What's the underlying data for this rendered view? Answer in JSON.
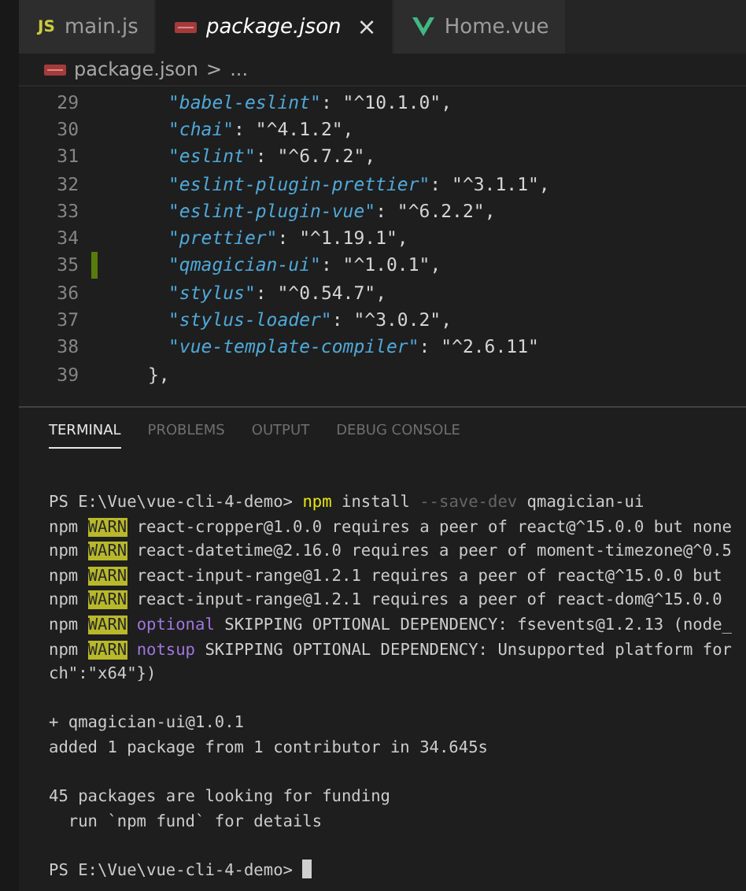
{
  "tabs": [
    {
      "label": "main.js",
      "icon": {
        "kind": "js",
        "text": "JS"
      },
      "selected": false,
      "preview": false
    },
    {
      "label": "package.json",
      "icon": {
        "kind": "json"
      },
      "selected": true,
      "preview": true,
      "close": "×"
    },
    {
      "label": "Home.vue",
      "icon": {
        "kind": "vue"
      },
      "selected": false,
      "preview": false
    }
  ],
  "breadcrumb": {
    "file": "package.json",
    "icon": {
      "kind": "json"
    },
    "separator": ">",
    "rest": "..."
  },
  "editor": {
    "lines": [
      {
        "number": "29",
        "kind": "entry",
        "modified": false,
        "segments": [
          {
            "kind": "key",
            "text": "\"babel-eslint\""
          },
          {
            "kind": "punct",
            "text": ": "
          },
          {
            "kind": "string",
            "text": "\"^10.1.0\""
          },
          {
            "kind": "punct",
            "text": ","
          }
        ]
      },
      {
        "number": "30",
        "kind": "entry",
        "modified": false,
        "segments": [
          {
            "kind": "key",
            "text": "\"chai\""
          },
          {
            "kind": "punct",
            "text": ": "
          },
          {
            "kind": "string",
            "text": "\"^4.1.2\""
          },
          {
            "kind": "punct",
            "text": ","
          }
        ]
      },
      {
        "number": "31",
        "kind": "entry",
        "modified": false,
        "segments": [
          {
            "kind": "key",
            "text": "\"eslint\""
          },
          {
            "kind": "punct",
            "text": ": "
          },
          {
            "kind": "string",
            "text": "\"^6.7.2\""
          },
          {
            "kind": "punct",
            "text": ","
          }
        ]
      },
      {
        "number": "32",
        "kind": "entry",
        "modified": false,
        "segments": [
          {
            "kind": "key",
            "text": "\"eslint-plugin-prettier\""
          },
          {
            "kind": "punct",
            "text": ": "
          },
          {
            "kind": "string",
            "text": "\"^3.1.1\""
          },
          {
            "kind": "punct",
            "text": ","
          }
        ]
      },
      {
        "number": "33",
        "kind": "entry",
        "modified": false,
        "segments": [
          {
            "kind": "key",
            "text": "\"eslint-plugin-vue\""
          },
          {
            "kind": "punct",
            "text": ": "
          },
          {
            "kind": "string",
            "text": "\"^6.2.2\""
          },
          {
            "kind": "punct",
            "text": ","
          }
        ]
      },
      {
        "number": "34",
        "kind": "entry",
        "modified": false,
        "segments": [
          {
            "kind": "key",
            "text": "\"prettier\""
          },
          {
            "kind": "punct",
            "text": ": "
          },
          {
            "kind": "string",
            "text": "\"^1.19.1\""
          },
          {
            "kind": "punct",
            "text": ","
          }
        ]
      },
      {
        "number": "35",
        "kind": "entry",
        "modified": true,
        "segments": [
          {
            "kind": "key",
            "text": "\"qmagician-ui\""
          },
          {
            "kind": "punct",
            "text": ": "
          },
          {
            "kind": "string",
            "text": "\"^1.0.1\""
          },
          {
            "kind": "punct",
            "text": ","
          }
        ]
      },
      {
        "number": "36",
        "kind": "entry",
        "modified": false,
        "segments": [
          {
            "kind": "key",
            "text": "\"stylus\""
          },
          {
            "kind": "punct",
            "text": ": "
          },
          {
            "kind": "string",
            "text": "\"^0.54.7\""
          },
          {
            "kind": "punct",
            "text": ","
          }
        ]
      },
      {
        "number": "37",
        "kind": "entry",
        "modified": false,
        "segments": [
          {
            "kind": "key",
            "text": "\"stylus-loader\""
          },
          {
            "kind": "punct",
            "text": ": "
          },
          {
            "kind": "string",
            "text": "\"^3.0.2\""
          },
          {
            "kind": "punct",
            "text": ","
          }
        ]
      },
      {
        "number": "38",
        "kind": "entry",
        "modified": false,
        "segments": [
          {
            "kind": "key",
            "text": "\"vue-template-compiler\""
          },
          {
            "kind": "punct",
            "text": ": "
          },
          {
            "kind": "string",
            "text": "\"^2.6.11\""
          }
        ]
      },
      {
        "number": "39",
        "kind": "close",
        "modified": false,
        "segments": [
          {
            "kind": "punct",
            "text": "},"
          }
        ]
      }
    ]
  },
  "panel": {
    "tabs": [
      {
        "label": "TERMINAL",
        "selected": true
      },
      {
        "label": "PROBLEMS",
        "selected": false
      },
      {
        "label": "OUTPUT",
        "selected": false
      },
      {
        "label": "DEBUG CONSOLE",
        "selected": false
      }
    ],
    "terminal": {
      "lines": [
        {
          "kind": "output",
          "segments": [
            {
              "kind": "plain",
              "text": "PS E:\\Vue\\vue-cli-4-demo> "
            },
            {
              "kind": "command",
              "text": "npm"
            },
            {
              "kind": "plain",
              "text": " install "
            },
            {
              "kind": "dim",
              "text": "--save-dev"
            },
            {
              "kind": "plain",
              "text": " qmagician-ui"
            }
          ]
        },
        {
          "kind": "output",
          "segments": [
            {
              "kind": "plain",
              "text": "npm "
            },
            {
              "kind": "warn",
              "text": "WARN"
            },
            {
              "kind": "plain",
              "text": " react-cropper@1.0.0 requires a peer of react@^15.0.0 but none"
            }
          ]
        },
        {
          "kind": "output",
          "segments": [
            {
              "kind": "plain",
              "text": "npm "
            },
            {
              "kind": "warn",
              "text": "WARN"
            },
            {
              "kind": "plain",
              "text": " react-datetime@2.16.0 requires a peer of moment-timezone@^0.5"
            }
          ]
        },
        {
          "kind": "output",
          "segments": [
            {
              "kind": "plain",
              "text": "npm "
            },
            {
              "kind": "warn",
              "text": "WARN"
            },
            {
              "kind": "plain",
              "text": " react-input-range@1.2.1 requires a peer of react@^15.0.0 but"
            }
          ]
        },
        {
          "kind": "output",
          "segments": [
            {
              "kind": "plain",
              "text": "npm "
            },
            {
              "kind": "warn",
              "text": "WARN"
            },
            {
              "kind": "plain",
              "text": " react-input-range@1.2.1 requires a peer of react-dom@^15.0.0"
            }
          ]
        },
        {
          "kind": "output",
          "segments": [
            {
              "kind": "plain",
              "text": "npm "
            },
            {
              "kind": "warn",
              "text": "WARN"
            },
            {
              "kind": "tag",
              "text": "optional"
            },
            {
              "kind": "plain",
              "text": " SKIPPING OPTIONAL DEPENDENCY: fsevents@1.2.13 (node_"
            }
          ]
        },
        {
          "kind": "output",
          "segments": [
            {
              "kind": "plain",
              "text": "npm "
            },
            {
              "kind": "warn",
              "text": "WARN"
            },
            {
              "kind": "tag",
              "text": "notsup"
            },
            {
              "kind": "plain",
              "text": " SKIPPING OPTIONAL DEPENDENCY: Unsupported platform for"
            }
          ]
        },
        {
          "kind": "output",
          "segments": [
            {
              "kind": "plain",
              "text": "ch\":\"x64\"})"
            }
          ]
        },
        {
          "kind": "blank"
        },
        {
          "kind": "output",
          "segments": [
            {
              "kind": "plain",
              "text": "+ qmagician-ui@1.0.1"
            }
          ]
        },
        {
          "kind": "output",
          "segments": [
            {
              "kind": "plain",
              "text": "added 1 package from 1 contributor in 34.645s"
            }
          ]
        },
        {
          "kind": "blank"
        },
        {
          "kind": "output",
          "segments": [
            {
              "kind": "plain",
              "text": "45 packages are looking for funding"
            }
          ]
        },
        {
          "kind": "output",
          "segments": [
            {
              "kind": "plain",
              "text": "  run `npm fund` for details"
            }
          ]
        },
        {
          "kind": "blank"
        },
        {
          "kind": "output",
          "segments": [
            {
              "kind": "plain",
              "text": "PS E:\\Vue\\vue-cli-4-demo> "
            }
          ]
        }
      ],
      "cursor": true
    }
  }
}
